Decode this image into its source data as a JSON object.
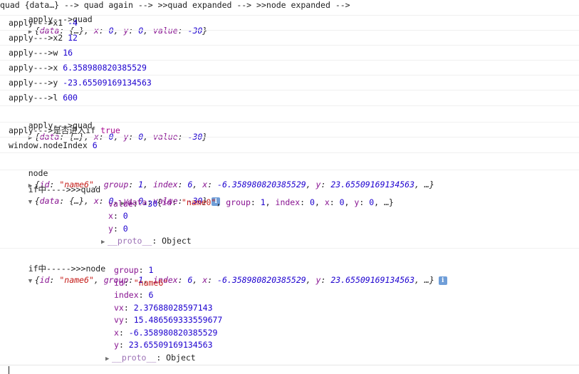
{
  "console": {
    "apply_prefix": "apply--->",
    "quad_label": "quad",
    "x1_label": "x1",
    "x1_value": "-4",
    "x2_label": "x2",
    "x2_value": "12",
    "w_label": "w",
    "w_value": "16",
    "x_label": "x",
    "x_value": "6.358980820385529",
    "y_label": "y",
    "y_value": "-23.65509169134563",
    "l_label": "l",
    "l_value": "600",
    "if_label": "是否进入if",
    "if_value": "true",
    "nodeindex_label": "window.nodeIndex",
    "nodeindex_value": "6",
    "node_label": "node",
    "ifquad_label": "if中---->>>quad",
    "ifnode_label": "if中----->>>node"
  },
  "quad_obj": {
    "open": "{",
    "data_key": "data",
    "data_val": "{…}",
    "x_key": "x",
    "x_val": "0",
    "y_key": "y",
    "y_val": "0",
    "value_key": "value",
    "value_val": "-30",
    "close": "}"
  },
  "node_obj": {
    "id_key": "id",
    "id_val": "\"name6\"",
    "group_key": "group",
    "group_val": "1",
    "index_key": "index",
    "index_val": "6",
    "x_key": "x",
    "x_val": "-6.358980820385529",
    "y_key": "y",
    "y_val": "23.65509169134563",
    "tail": "…}"
  },
  "quad_expanded": {
    "data_line_open": "{",
    "data_id_key": "id",
    "data_id_val": "\"name0\"",
    "data_group_key": "group",
    "data_group_val": "1",
    "data_index_key": "index",
    "data_index_val": "0",
    "data_x_key": "x",
    "data_x_val": "0",
    "data_y_key": "y",
    "data_y_val": "0",
    "data_tail": "…}",
    "value_key": "value",
    "value_val": "-30",
    "x_key": "x",
    "x_val": "0",
    "y_key": "y",
    "y_val": "0",
    "proto_key": "__proto__",
    "proto_val": "Object"
  },
  "node_expanded": {
    "group_key": "group",
    "group_val": "1",
    "id_key": "id",
    "id_val": "\"name6\"",
    "index_key": "index",
    "index_val": "6",
    "vx_key": "vx",
    "vx_val": "2.37688028597143",
    "vy_key": "vy",
    "vy_val": "15.486569333559677",
    "x_key": "x",
    "x_val": "-6.358980820385529",
    "y_key": "y",
    "y_val": "23.65509169134563",
    "proto_key": "__proto__",
    "proto_val": "Object"
  },
  "icons": {
    "expand": "expand-triangle-icon",
    "collapse": "collapse-triangle-icon",
    "info": "info-icon"
  },
  "colors": {
    "number": "#1c00cf",
    "string": "#c41a16",
    "key": "#881391",
    "keyword": "#aa0d91",
    "info_badge": "#6f9ed8"
  }
}
